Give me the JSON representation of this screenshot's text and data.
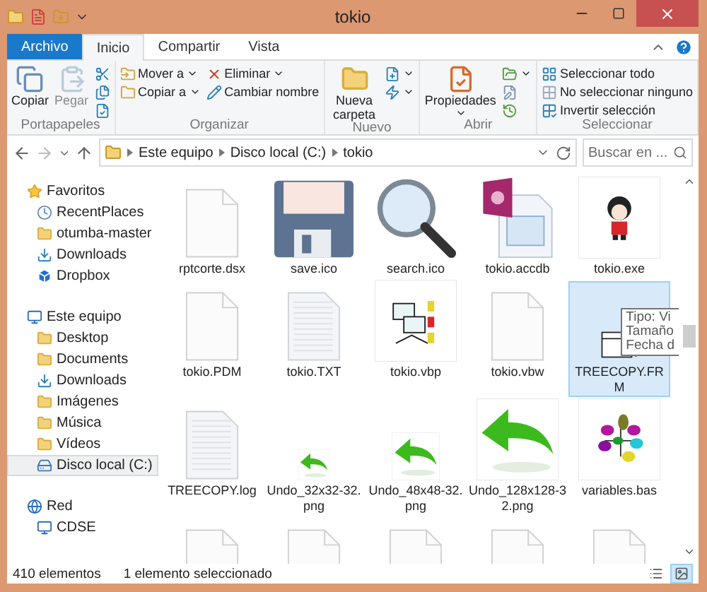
{
  "window": {
    "title": "tokio"
  },
  "ribbon": {
    "tabs": [
      {
        "label": "Archivo",
        "kind": "file",
        "selected": false
      },
      {
        "label": "Inicio",
        "kind": "tab",
        "selected": true
      },
      {
        "label": "Compartir",
        "kind": "tab",
        "selected": false
      },
      {
        "label": "Vista",
        "kind": "tab",
        "selected": false
      }
    ],
    "groups": [
      {
        "label": "Portapapeles",
        "columns": [
          [
            {
              "label": "Copiar",
              "kind": "large",
              "disabled": false
            }
          ],
          [
            {
              "label": "Pegar",
              "kind": "large",
              "disabled": true
            }
          ],
          [
            {
              "kind": "small",
              "disabled": false
            },
            {
              "kind": "small",
              "disabled": false
            },
            {
              "kind": "small",
              "disabled": false
            }
          ]
        ]
      },
      {
        "label": "Organizar",
        "columns": [
          [
            {
              "label": "Mover a",
              "kind": "small",
              "menu": true,
              "disabled": false
            },
            {
              "label": "Copiar a",
              "kind": "small",
              "menu": true,
              "disabled": false
            }
          ],
          [
            {
              "label": "Eliminar",
              "kind": "small",
              "menu": true,
              "disabled": false
            },
            {
              "label": "Cambiar nombre",
              "kind": "small",
              "menu": false,
              "disabled": false
            }
          ]
        ]
      },
      {
        "label": "Nuevo",
        "columns": [
          [
            {
              "label": "Nueva carpeta",
              "kind": "large",
              "disabled": false
            }
          ],
          [
            {
              "kind": "small",
              "menu": true,
              "disabled": false
            },
            {
              "kind": "small",
              "menu": true,
              "disabled": false
            }
          ]
        ]
      },
      {
        "label": "Abrir",
        "columns": [
          [
            {
              "label": "Propiedades",
              "kind": "large",
              "menu": true,
              "disabled": false
            }
          ],
          [
            {
              "kind": "small",
              "menu": true,
              "disabled": false
            },
            {
              "kind": "small",
              "menu": false,
              "disabled": false
            },
            {
              "kind": "small",
              "menu": false,
              "disabled": false
            }
          ]
        ]
      },
      {
        "label": "Seleccionar",
        "columns": [
          [
            {
              "label": "Seleccionar todo",
              "kind": "small",
              "disabled": false
            },
            {
              "label": "No seleccionar ninguno",
              "kind": "small",
              "disabled": false
            },
            {
              "label": "Invertir selección",
              "kind": "small",
              "disabled": false
            }
          ]
        ]
      }
    ]
  },
  "address": {
    "path": [
      "Este equipo",
      "Disco local (C:)",
      "tokio"
    ],
    "search": {
      "placeholder": "Buscar en ..."
    }
  },
  "sidebar": {
    "sections": [
      {
        "label": "Favoritos",
        "kind": "favorites",
        "children": [
          {
            "label": "RecentPlaces",
            "kind": "recent",
            "selected": false
          },
          {
            "label": "otumba-master",
            "kind": "folder",
            "selected": false
          },
          {
            "label": "Downloads",
            "kind": "downloads",
            "selected": false
          },
          {
            "label": "Dropbox",
            "kind": "dropbox",
            "selected": false
          }
        ]
      },
      {
        "label": "Este equipo",
        "kind": "computer",
        "children": [
          {
            "label": "Desktop",
            "kind": "folder",
            "selected": false
          },
          {
            "label": "Documents",
            "kind": "folder",
            "selected": false
          },
          {
            "label": "Downloads",
            "kind": "downloads",
            "selected": false
          },
          {
            "label": "Imágenes",
            "kind": "folder",
            "selected": false
          },
          {
            "label": "Música",
            "kind": "folder",
            "selected": false
          },
          {
            "label": "Vídeos",
            "kind": "folder",
            "selected": false
          },
          {
            "label": "Disco local (C:)",
            "kind": "drive",
            "selected": true
          }
        ]
      },
      {
        "label": "Red",
        "kind": "network",
        "children": [
          {
            "label": "CDSE",
            "kind": "computer",
            "selected": false
          }
        ]
      }
    ]
  },
  "files": [
    {
      "name": "rptcorte.dsx",
      "kind": "blank",
      "selected": false
    },
    {
      "name": "save.ico",
      "kind": "floppy",
      "selected": false
    },
    {
      "name": "search.ico",
      "kind": "magnifier",
      "selected": false
    },
    {
      "name": "tokio.accdb",
      "kind": "database",
      "selected": false
    },
    {
      "name": "tokio.exe",
      "kind": "character",
      "selected": false
    },
    {
      "name": "tokio.PDM",
      "kind": "blank",
      "selected": false
    },
    {
      "name": "tokio.TXT",
      "kind": "text",
      "selected": false
    },
    {
      "name": "tokio.vbp",
      "kind": "project",
      "selected": false
    },
    {
      "name": "tokio.vbw",
      "kind": "blank",
      "selected": false
    },
    {
      "name": "TREECOPY.FRM",
      "kind": "form",
      "selected": true
    },
    {
      "name": "TREECOPY.log",
      "kind": "text",
      "selected": false
    },
    {
      "name": "Undo_32x32-32.png",
      "kind": "undo-small",
      "selected": false
    },
    {
      "name": "Undo_48x48-32.png",
      "kind": "undo-medium",
      "selected": false
    },
    {
      "name": "Undo_128x128-32.png",
      "kind": "undo-large",
      "selected": false
    },
    {
      "name": "variables.bas",
      "kind": "module",
      "selected": false
    },
    {
      "kind": "blank",
      "selected": false
    },
    {
      "kind": "blank",
      "selected": false
    },
    {
      "kind": "blank",
      "selected": false
    },
    {
      "kind": "blank",
      "selected": false
    },
    {
      "kind": "blank",
      "selected": false
    }
  ],
  "tooltip": {
    "lines": [
      "Tipo: Vi",
      "Tamaño",
      "Fecha d"
    ]
  },
  "status_bar": {
    "items": [
      "410 elementos",
      "1 elemento seleccionado"
    ],
    "views": [
      {
        "kind": "details",
        "selected": false
      },
      {
        "kind": "icons",
        "selected": true
      }
    ]
  }
}
